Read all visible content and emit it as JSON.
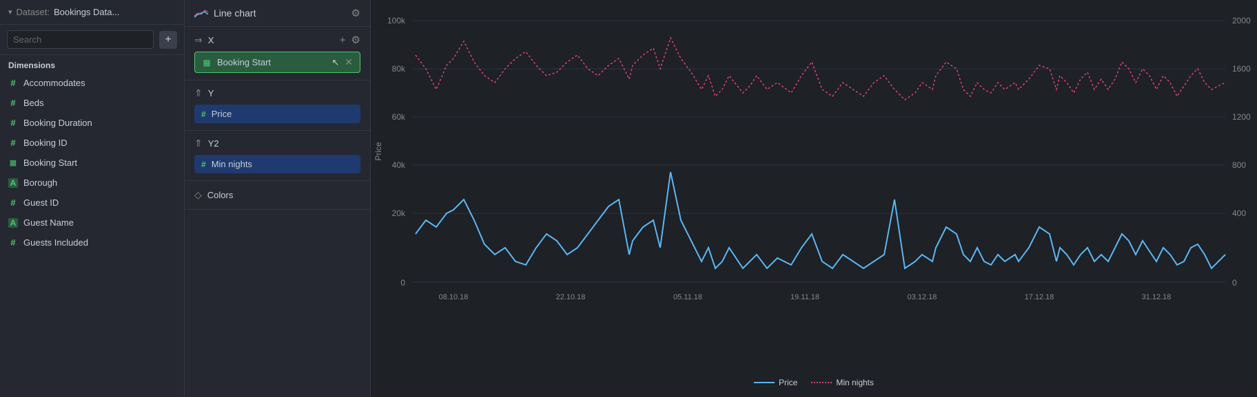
{
  "dataset": {
    "label": "Dataset:",
    "name": "Bookings Data..."
  },
  "search": {
    "placeholder": "Search"
  },
  "dimensions": {
    "section_label": "Dimensions",
    "items": [
      {
        "id": "accommodates",
        "label": "Accommodates",
        "icon": "hash"
      },
      {
        "id": "beds",
        "label": "Beds",
        "icon": "hash"
      },
      {
        "id": "booking_duration",
        "label": "Booking Duration",
        "icon": "hash"
      },
      {
        "id": "booking_id",
        "label": "Booking ID",
        "icon": "hash"
      },
      {
        "id": "booking_start",
        "label": "Booking Start",
        "icon": "cal"
      },
      {
        "id": "borough",
        "label": "Borough",
        "icon": "a"
      },
      {
        "id": "guest_id",
        "label": "Guest ID",
        "icon": "hash"
      },
      {
        "id": "guest_name",
        "label": "Guest Name",
        "icon": "a"
      },
      {
        "id": "guests_included",
        "label": "Guests Included",
        "icon": "hash"
      }
    ]
  },
  "chart": {
    "title": "Line chart",
    "x_label": "X",
    "y_label": "Y",
    "y2_label": "Y2",
    "colors_label": "Colors",
    "x_field": "Booking Start",
    "y_field": "Price",
    "y2_field": "Min nights"
  },
  "chart_axes": {
    "y_left_labels": [
      "100k",
      "80k",
      "60k",
      "40k",
      "20k",
      "0"
    ],
    "y_right_labels": [
      "2000",
      "1600",
      "1200",
      "800",
      "400",
      "0"
    ],
    "x_labels": [
      "08.10.18",
      "22.10.18",
      "05.11.18",
      "19.11.18",
      "03.12.18",
      "17.12.18",
      "31.12.18"
    ],
    "y_axis_title": "Price"
  },
  "legend": {
    "price_label": "Price",
    "min_nights_label": "Min nights"
  }
}
